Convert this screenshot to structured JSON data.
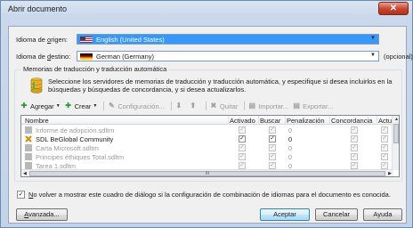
{
  "window": {
    "title": "Abrir documento",
    "close_glyph": "✕"
  },
  "source": {
    "label_pre": "Idioma de ",
    "label_ul": "o",
    "label_post": "rigen:",
    "value": "English (United States)",
    "flag": "us-flag-icon"
  },
  "target": {
    "label_pre": "Idioma de ",
    "label_ul": "d",
    "label_post": "estino:",
    "value": "German (Germany)",
    "optional": "(opcional)",
    "flag": "de-flag-icon"
  },
  "tm": {
    "group_title": "Memorias de traducción y traducción automática",
    "description": "Seleccione los servidores de memorias de traducción y traducción automática, y especifique si desea incluirlos en la búsquedas y búsquedas de concordancia, y si desea actualizarlos."
  },
  "toolbar": {
    "add": "Agregar",
    "create": "Crear",
    "configure": "Configuración...",
    "remove": "Quitar",
    "import": "Importar...",
    "export": "Exportar..."
  },
  "grid": {
    "columns": [
      "Nombre",
      "Activado",
      "Buscar",
      "Penalización",
      "Concordancia",
      "Actualiz"
    ],
    "rows": [
      {
        "name": "Informe de adopción.sdltm",
        "enabled": true,
        "search": true,
        "penalty": "0",
        "concordance": true,
        "update": true,
        "disabled": true
      },
      {
        "name": "SDL BeGlobal Community",
        "enabled": true,
        "search": true,
        "penalty": "0",
        "concordance": true,
        "update": true,
        "disabled": false
      },
      {
        "name": "Carta Microsoft.sdltm",
        "enabled": true,
        "search": true,
        "penalty": "0",
        "concordance": true,
        "update": true,
        "disabled": true
      },
      {
        "name": "Principes éthiques Total.sdltm",
        "enabled": true,
        "search": true,
        "penalty": "0",
        "concordance": true,
        "update": true,
        "disabled": true
      },
      {
        "name": "Tarea 1.sdltm",
        "enabled": true,
        "search": true,
        "penalty": "0",
        "concordance": true,
        "update": true,
        "disabled": true
      }
    ],
    "scroll_grip": "III"
  },
  "dont_show": {
    "checked": true,
    "text_ul": "N",
    "text_rest": "o volver a mostrar este cuadro de diálogo si la configuración de combinación de idiomas para el documento es conocida."
  },
  "buttons": {
    "advanced_ul": "A",
    "advanced_rest": "vanzada...",
    "accept": "Aceptar",
    "cancel": "Cancelar",
    "help": "Ayuda"
  }
}
